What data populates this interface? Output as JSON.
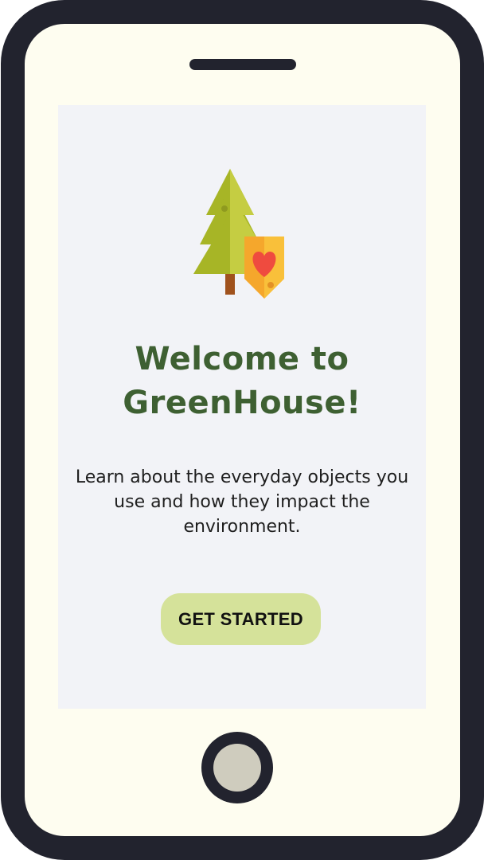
{
  "welcome": {
    "title_line1": "Welcome to",
    "title_line2": "GreenHouse!",
    "description": "Learn about the everyday objects you use and how they impact the environment.",
    "cta_label": "GET STARTED"
  },
  "icons": {
    "logo": "tree-with-heart-shield-icon",
    "home_button": "home-button-icon"
  },
  "colors": {
    "phone_frame": "#22232e",
    "phone_body": "#fefdf0",
    "screen_bg": "#f2f3f7",
    "title_green": "#3e6032",
    "button_bg": "#d5e29a"
  }
}
